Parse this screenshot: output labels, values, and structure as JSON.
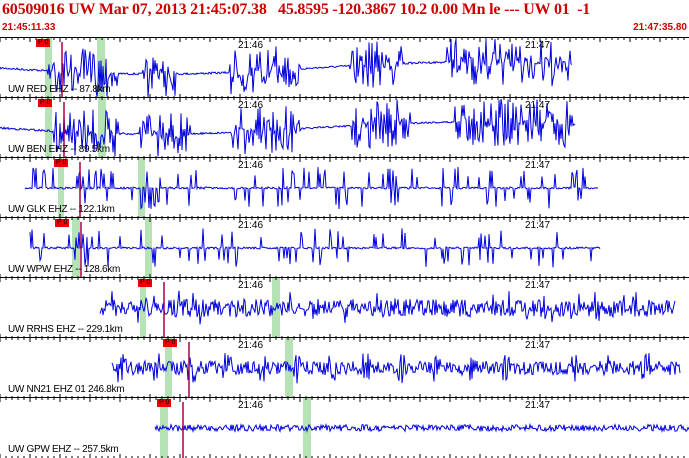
{
  "header": {
    "title": "60509016 UW Mar 07, 2013 21:45:07.38   45.8595 -120.3867 10.2 0.00 Mn le --- UW 01  -1",
    "time_start": "21:45:11.33",
    "time_end": "21:47:35.80"
  },
  "minute_labels": [
    "21:46",
    "21:47"
  ],
  "colors": {
    "trace": "#0000dd",
    "pick": "#ee0000",
    "window": "#b6e3b6",
    "title": "#cc0000"
  },
  "traces": [
    {
      "label": "UW RED EHZ -- 87.8km",
      "pick": "P 0"
    },
    {
      "label": "UW BEN EHZ -- 89.5km",
      "pick": "P 0"
    },
    {
      "label": "UW GLK EHZ -- 122.1km",
      "pick": "P 0"
    },
    {
      "label": "UW WPW EHZ -- 128.6km",
      "pick": "P 0"
    },
    {
      "label": "UW RRHS EHZ -- 229.1km",
      "pick": "P 0"
    },
    {
      "label": "UW NN21 EHZ 01 246.8km",
      "pick": "P 0"
    },
    {
      "label": "UW GPW EHZ -- 257.5km",
      "pick": "P 0"
    }
  ]
}
